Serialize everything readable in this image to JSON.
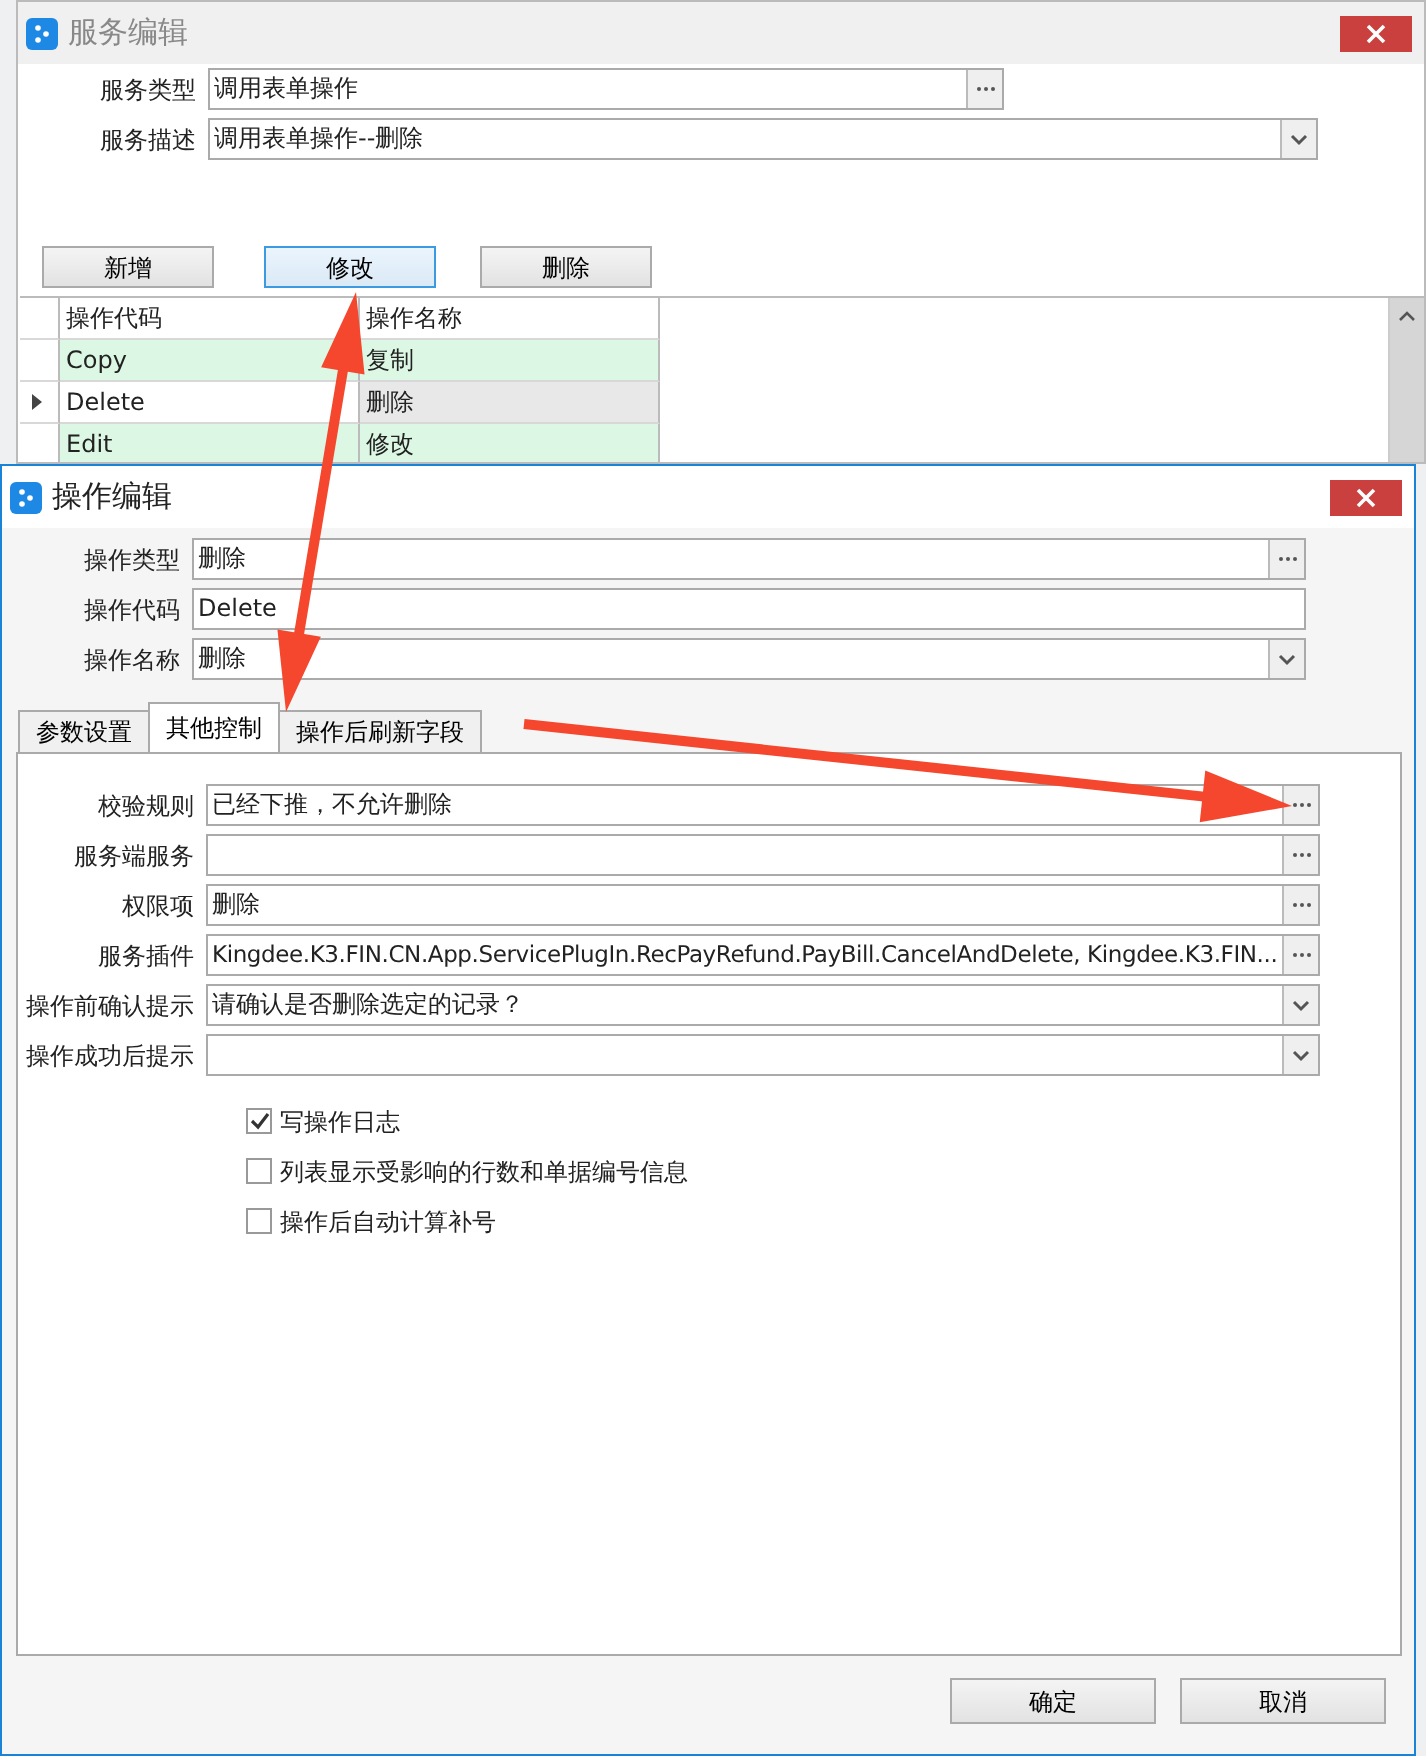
{
  "service_window": {
    "title": "服务编辑",
    "fields": [
      {
        "label": "服务类型",
        "kind": "picker",
        "value": "调用表单操作"
      },
      {
        "label": "服务描述",
        "kind": "dropdown",
        "value": "调用表单操作--删除"
      }
    ],
    "buttons": [
      {
        "label": "新增",
        "selected": false
      },
      {
        "label": "修改",
        "selected": true
      },
      {
        "label": "删除",
        "selected": false
      }
    ],
    "table": {
      "columns": [
        "操作代码",
        "操作名称"
      ],
      "rows": [
        {
          "cells": [
            "Copy",
            "复制"
          ],
          "current": false
        },
        {
          "cells": [
            "Delete",
            "删除"
          ],
          "current": true
        },
        {
          "cells": [
            "Edit",
            "修改"
          ],
          "current": false
        }
      ]
    }
  },
  "operation_dialog": {
    "title": "操作编辑",
    "fields": [
      {
        "label": "操作类型",
        "kind": "picker",
        "value": "删除"
      },
      {
        "label": "操作代码",
        "kind": "text",
        "value": "Delete"
      },
      {
        "label": "操作名称",
        "kind": "dropdown",
        "value": "删除"
      }
    ],
    "tabs": [
      {
        "label": "参数设置",
        "selected": false
      },
      {
        "label": "其他控制",
        "selected": true
      },
      {
        "label": "操作后刷新字段",
        "selected": false
      }
    ],
    "tab_fields": [
      {
        "label": "校验规则",
        "kind": "picker",
        "value": "已经下推，不允许删除"
      },
      {
        "label": "服务端服务",
        "kind": "picker"
      },
      {
        "label": "权限项",
        "kind": "picker",
        "value": "删除"
      },
      {
        "label": "服务插件",
        "kind": "picker",
        "value": "Kingdee.K3.FIN.CN.App.ServicePlugIn.RecPayRefund.PayBill.CancelAndDelete, Kingdee.K3.FIN..."
      },
      {
        "label": "操作前确认提示",
        "kind": "dropdown",
        "value": "请确认是否删除选定的记录？"
      },
      {
        "label": "操作成功后提示",
        "kind": "dropdown"
      }
    ],
    "checkboxes": [
      {
        "label": "写操作日志",
        "checked": true
      },
      {
        "label": "列表显示受影响的行数和单据编号信息",
        "checked": false
      },
      {
        "label": "操作后自动计算补号",
        "checked": false
      }
    ],
    "buttons": [
      "确定",
      "取消"
    ]
  }
}
